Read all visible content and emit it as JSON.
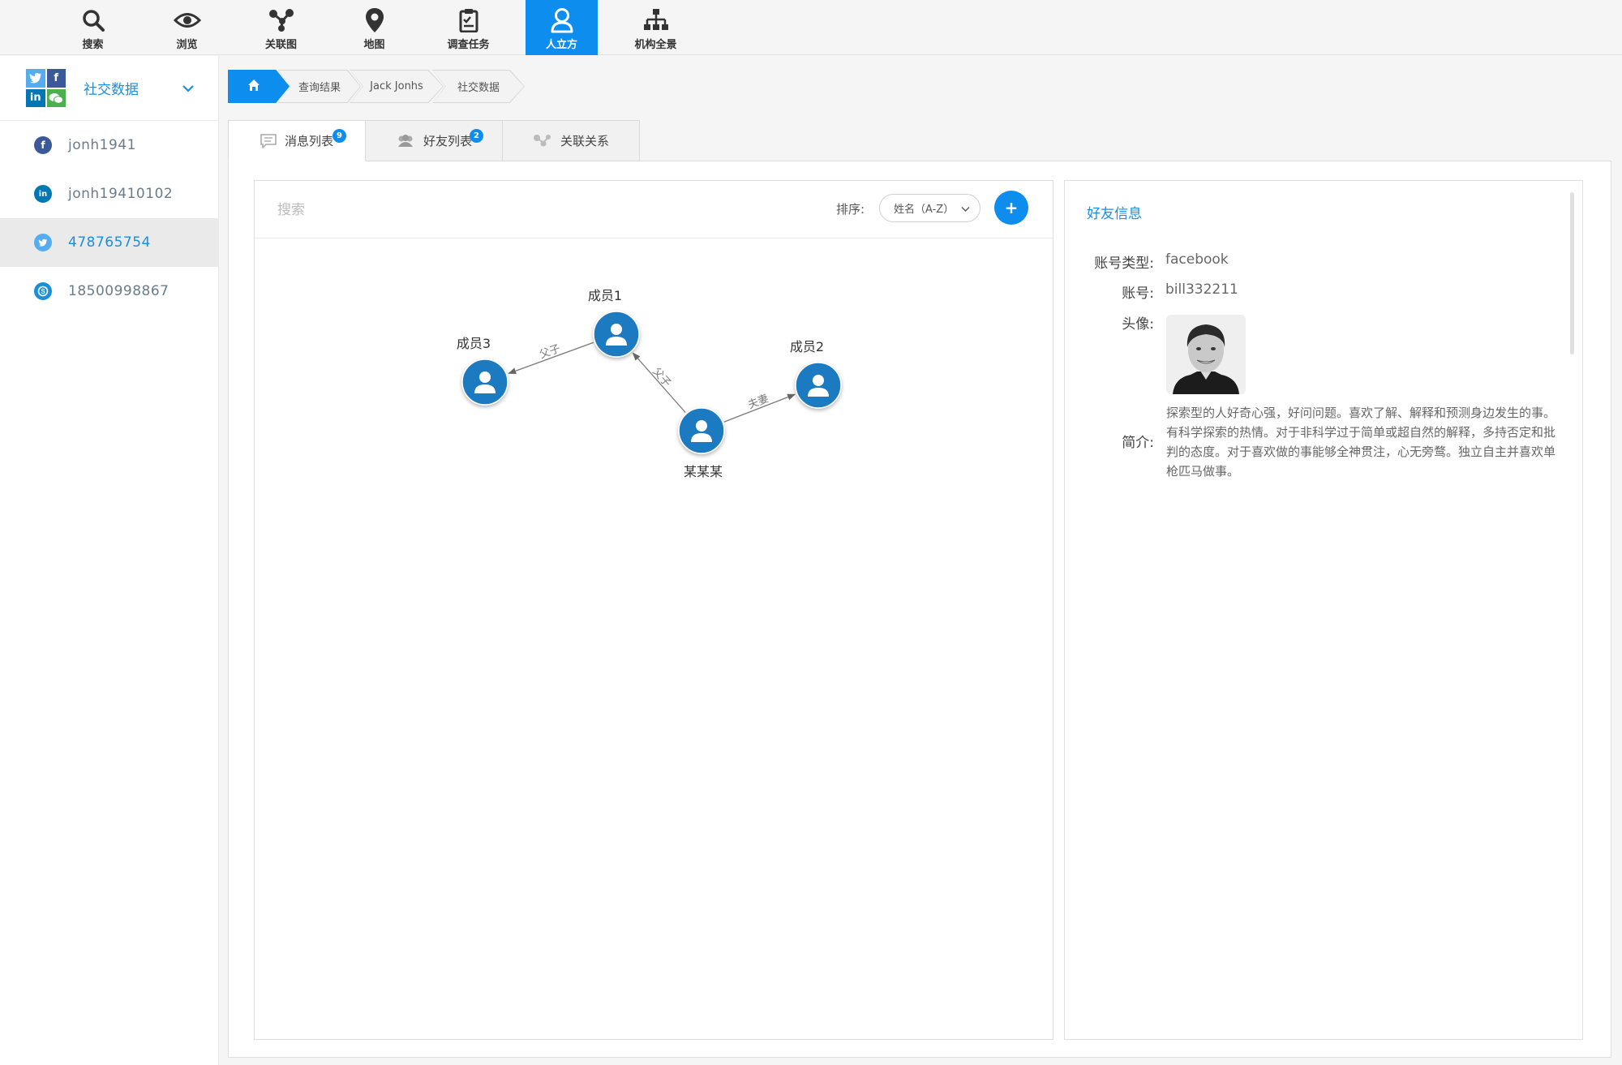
{
  "nav": {
    "items": [
      {
        "label": "搜索",
        "icon": "search-icon"
      },
      {
        "label": "浏览",
        "icon": "eye-icon"
      },
      {
        "label": "关联图",
        "icon": "graph-icon"
      },
      {
        "label": "地图",
        "icon": "map-pin-icon"
      },
      {
        "label": "调查任务",
        "icon": "clipboard-icon"
      },
      {
        "label": "人立方",
        "icon": "person-icon"
      },
      {
        "label": "机构全景",
        "icon": "org-chart-icon"
      }
    ],
    "active": "人立方",
    "accent": "#0d8ded"
  },
  "sidebar": {
    "title": "社交数据",
    "logo_tiles": [
      {
        "glyph": "t",
        "color": "#55acee"
      },
      {
        "glyph": "f",
        "color": "#3b5998"
      },
      {
        "glyph": "in",
        "color": "#0077b5"
      },
      {
        "glyph": "w",
        "color": "#4caf50"
      }
    ],
    "items": [
      {
        "label": "jonh1941",
        "icon": "facebook-icon",
        "glyph": "f",
        "color": "#3b5998"
      },
      {
        "label": "jonh19410102",
        "icon": "linkedin-icon",
        "glyph": "in",
        "color": "#0077b5"
      },
      {
        "label": "478765754",
        "icon": "twitter-icon",
        "glyph": "t",
        "color": "#55acee"
      },
      {
        "label": "18500998867",
        "icon": "skype-icon",
        "glyph": "s",
        "color": "#1b8fd6"
      }
    ],
    "active_index": 2
  },
  "breadcrumb": [
    "查询结果",
    "Jack Jonhs",
    "社交数据"
  ],
  "tabs": [
    {
      "label": "消息列表",
      "badge": "9",
      "icon": "message-icon"
    },
    {
      "label": "好友列表",
      "badge": "2",
      "icon": "friends-icon"
    },
    {
      "label": "关联关系",
      "badge": "",
      "icon": "relation-icon"
    }
  ],
  "graph_panel": {
    "search_placeholder": "搜索",
    "sort_label": "排序:",
    "sort_value": "姓名（A-Z）",
    "add_label": "+"
  },
  "graph": {
    "nodes": [
      {
        "id": "main",
        "label": "某某某"
      },
      {
        "id": "m1",
        "label": "成员1"
      },
      {
        "id": "m2",
        "label": "成员2"
      },
      {
        "id": "m3",
        "label": "成员3"
      }
    ],
    "edges": [
      {
        "from": "m1",
        "to": "m3",
        "label": "父子"
      },
      {
        "from": "main",
        "to": "m1",
        "label": "父子"
      },
      {
        "from": "main",
        "to": "m2",
        "label": "夫妻"
      }
    ],
    "node_color": "#1f7ac0"
  },
  "info": {
    "title": "好友信息",
    "account_type_label": "账号类型:",
    "account_type": "facebook",
    "account_label": "账号:",
    "account": "bill332211",
    "avatar_label": "头像:",
    "bio_label": "简介:",
    "bio": "探索型的人好奇心强，好问问题。喜欢了解、解释和预测身边发生的事。有科学探索的热情。对于非科学过于简单或超自然的解释，多持否定和批判的态度。对于喜欢做的事能够全神贯注，心无旁鹜。独立自主并喜欢单枪匹马做事。"
  }
}
